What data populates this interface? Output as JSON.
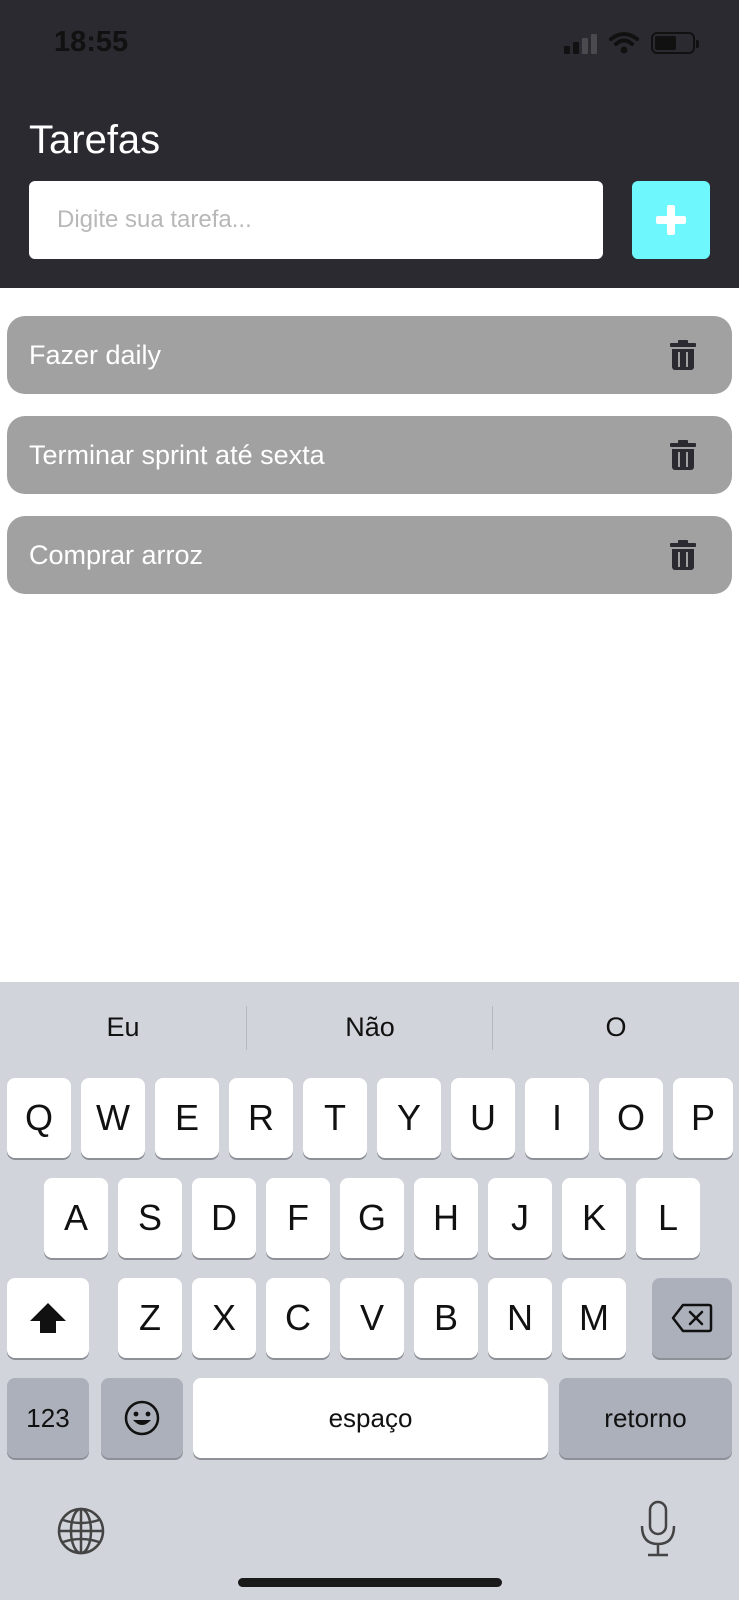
{
  "status_bar": {
    "time": "18:55"
  },
  "header": {
    "title": "Tarefas",
    "input_placeholder": "Digite sua tarefa...",
    "add_button_icon": "plus-icon",
    "accent_color": "#6ef7fc"
  },
  "tasks": [
    {
      "text": "Fazer daily",
      "icon": "trash-icon"
    },
    {
      "text": "Terminar sprint até sexta",
      "icon": "trash-icon"
    },
    {
      "text": "Comprar arroz",
      "icon": "trash-icon"
    }
  ],
  "keyboard": {
    "suggestions": [
      "Eu",
      "Não",
      "O"
    ],
    "row1": [
      "Q",
      "W",
      "E",
      "R",
      "T",
      "Y",
      "U",
      "I",
      "O",
      "P"
    ],
    "row2": [
      "A",
      "S",
      "D",
      "F",
      "G",
      "H",
      "J",
      "K",
      "L"
    ],
    "row3": [
      "Z",
      "X",
      "C",
      "V",
      "B",
      "N",
      "M"
    ],
    "numbers_label": "123",
    "space_label": "espaço",
    "return_label": "retorno"
  }
}
